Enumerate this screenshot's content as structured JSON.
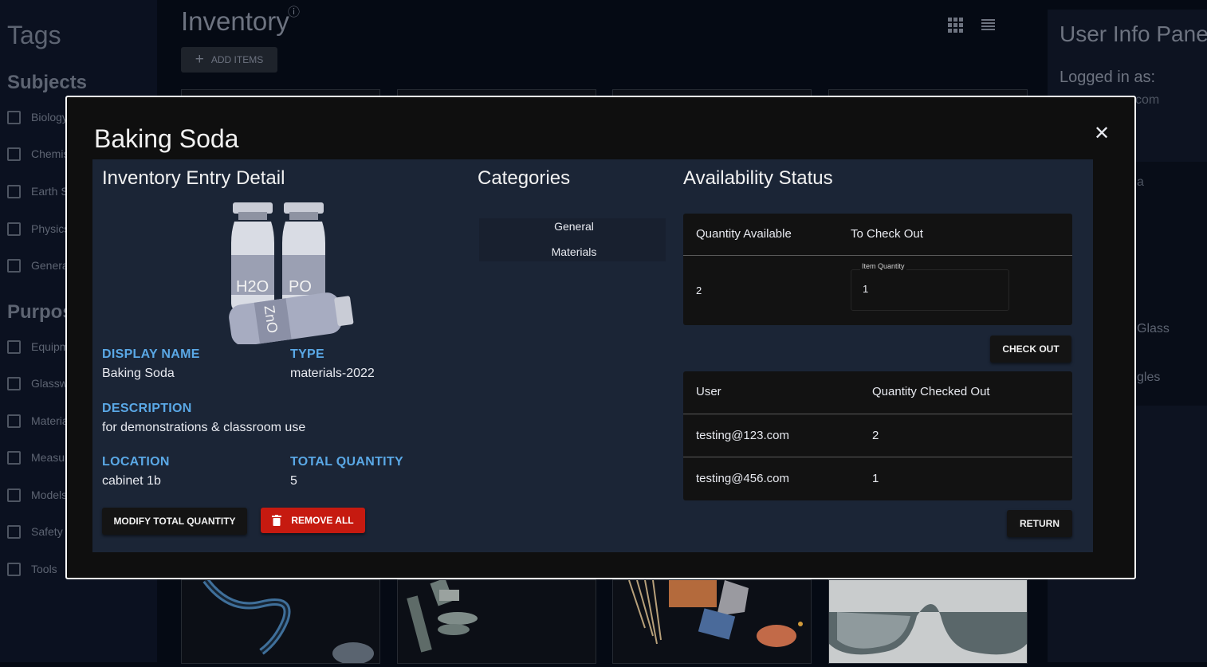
{
  "tags": {
    "title": "Tags",
    "subjects_heading": "Subjects",
    "subjects": [
      "Biology",
      "Chemis",
      "Earth S",
      "Physics",
      "Genera"
    ],
    "purpose_heading": "Purpos",
    "purposes": [
      "Equipm",
      "Glassw",
      "Materia",
      "Measur",
      "Models",
      "Safety",
      "Tools"
    ]
  },
  "inventory": {
    "title": "Inventory",
    "info_icon": "ⓘ",
    "add_items_label": "ADD ITEMS"
  },
  "user_panel": {
    "title": "User Info Pane",
    "logged_in": "Logged in as:",
    "email_partial": "com",
    "frag_a": "a",
    "frag_glass": "Glass",
    "frag_gles": "gles"
  },
  "modal": {
    "title": "Baking Soda",
    "close_icon": "✕",
    "entry_heading": "Inventory Entry Detail",
    "image_labels": [
      "H2O",
      "PO",
      "ZnO"
    ],
    "display_name_label": "DISPLAY NAME",
    "display_name": "Baking Soda",
    "type_label": "TYPE",
    "type": "materials-2022",
    "description_label": "DESCRIPTION",
    "description": "for demonstrations & classroom use",
    "location_label": "LOCATION",
    "location": "cabinet 1b",
    "total_quantity_label": "TOTAL QUANTITY",
    "total_quantity": "5",
    "modify_label": "MODIFY TOTAL QUANTITY",
    "remove_label": "REMOVE ALL",
    "categories_heading": "Categories",
    "categories": [
      "General",
      "Materials"
    ],
    "availability_heading": "Availability Status",
    "avail_col1": "Quantity Available",
    "avail_col2": "To Check Out",
    "quantity_available": "2",
    "item_quantity_label": "Item Quantity",
    "item_quantity_value": "1",
    "checkout_label": "CHECK OUT",
    "user_col": "User",
    "checked_col": "Quantity Checked Out",
    "checkouts": [
      {
        "user": "testing@123.com",
        "qty": "2"
      },
      {
        "user": "testing@456.com",
        "qty": "1"
      }
    ],
    "return_label": "RETURN"
  }
}
